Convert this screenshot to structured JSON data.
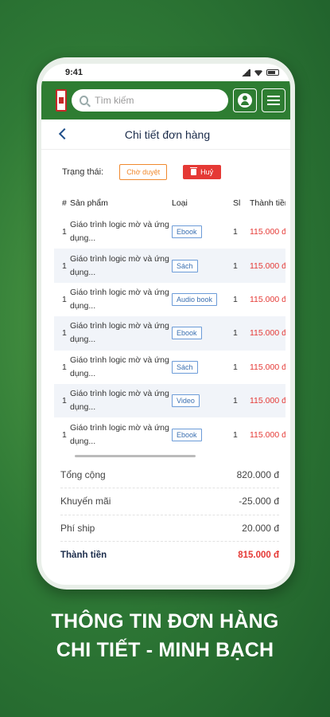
{
  "status_bar": {
    "time": "9:41"
  },
  "header": {
    "search_placeholder": "Tìm kiếm"
  },
  "nav": {
    "title": "Chi tiết đơn hàng"
  },
  "order": {
    "status_label": "Trạng thái:",
    "status_value": "Chờ duyệt",
    "cancel_label": "Huỷ"
  },
  "table": {
    "columns": [
      "#",
      "Sản phẩm",
      "Loại",
      "Sl",
      "Thành tiền"
    ],
    "rows": [
      {
        "idx": "1",
        "name": "Giáo trình logic mờ và ứng dụng...",
        "type": "Ebook",
        "qty": "1",
        "price": "115.000 đ"
      },
      {
        "idx": "1",
        "name": "Giáo trình logic mờ và ứng dụng...",
        "type": "Sách",
        "qty": "1",
        "price": "115.000 đ"
      },
      {
        "idx": "1",
        "name": "Giáo trình logic mờ và ứng dụng...",
        "type": "Audio book",
        "qty": "1",
        "price": "115.000 đ"
      },
      {
        "idx": "1",
        "name": "Giáo trình logic mờ và ứng dụng...",
        "type": "Ebook",
        "qty": "1",
        "price": "115.000 đ"
      },
      {
        "idx": "1",
        "name": "Giáo trình logic mờ và ứng dụng...",
        "type": "Sách",
        "qty": "1",
        "price": "115.000 đ"
      },
      {
        "idx": "1",
        "name": "Giáo trình logic mờ và ứng dụng...",
        "type": "Video",
        "qty": "1",
        "price": "115.000 đ"
      },
      {
        "idx": "1",
        "name": "Giáo trình logic mờ và ứng dụng...",
        "type": "Ebook",
        "qty": "1",
        "price": "115.000 đ"
      }
    ]
  },
  "summary": {
    "subtotal_label": "Tổng cộng",
    "subtotal_value": "820.000 đ",
    "discount_label": "Khuyến mãi",
    "discount_value": "-25.000 đ",
    "shipping_label": "Phí ship",
    "shipping_value": "20.000 đ",
    "total_label": "Thành tiền",
    "total_value": "815.000 đ"
  },
  "caption": {
    "line1": "THÔNG TIN ĐƠN HÀNG",
    "line2": "CHI TIẾT - MINH BẠCH"
  },
  "colors": {
    "brand_green": "#2e7d32",
    "accent_red": "#e53935",
    "pending_orange": "#f0892e"
  }
}
